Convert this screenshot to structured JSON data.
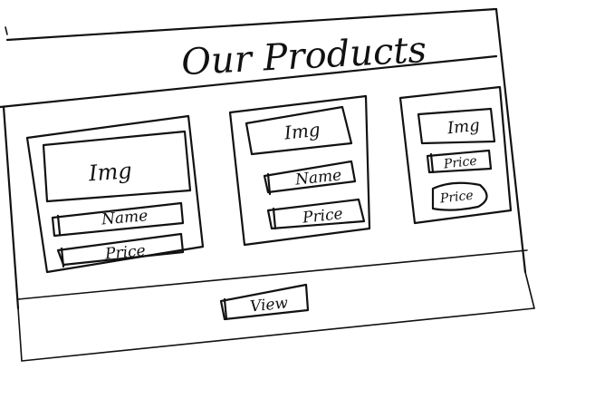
{
  "page": {
    "title": "Our Products"
  },
  "products": [
    {
      "img_label": "Img",
      "name_label": "Name",
      "price_label": "Price"
    },
    {
      "img_label": "Img",
      "name_label": "Name",
      "price_label": "Price"
    },
    {
      "img_label": "Img",
      "name_label": "Price",
      "price_label": "Price"
    }
  ],
  "footer": {
    "button_label": "View"
  }
}
